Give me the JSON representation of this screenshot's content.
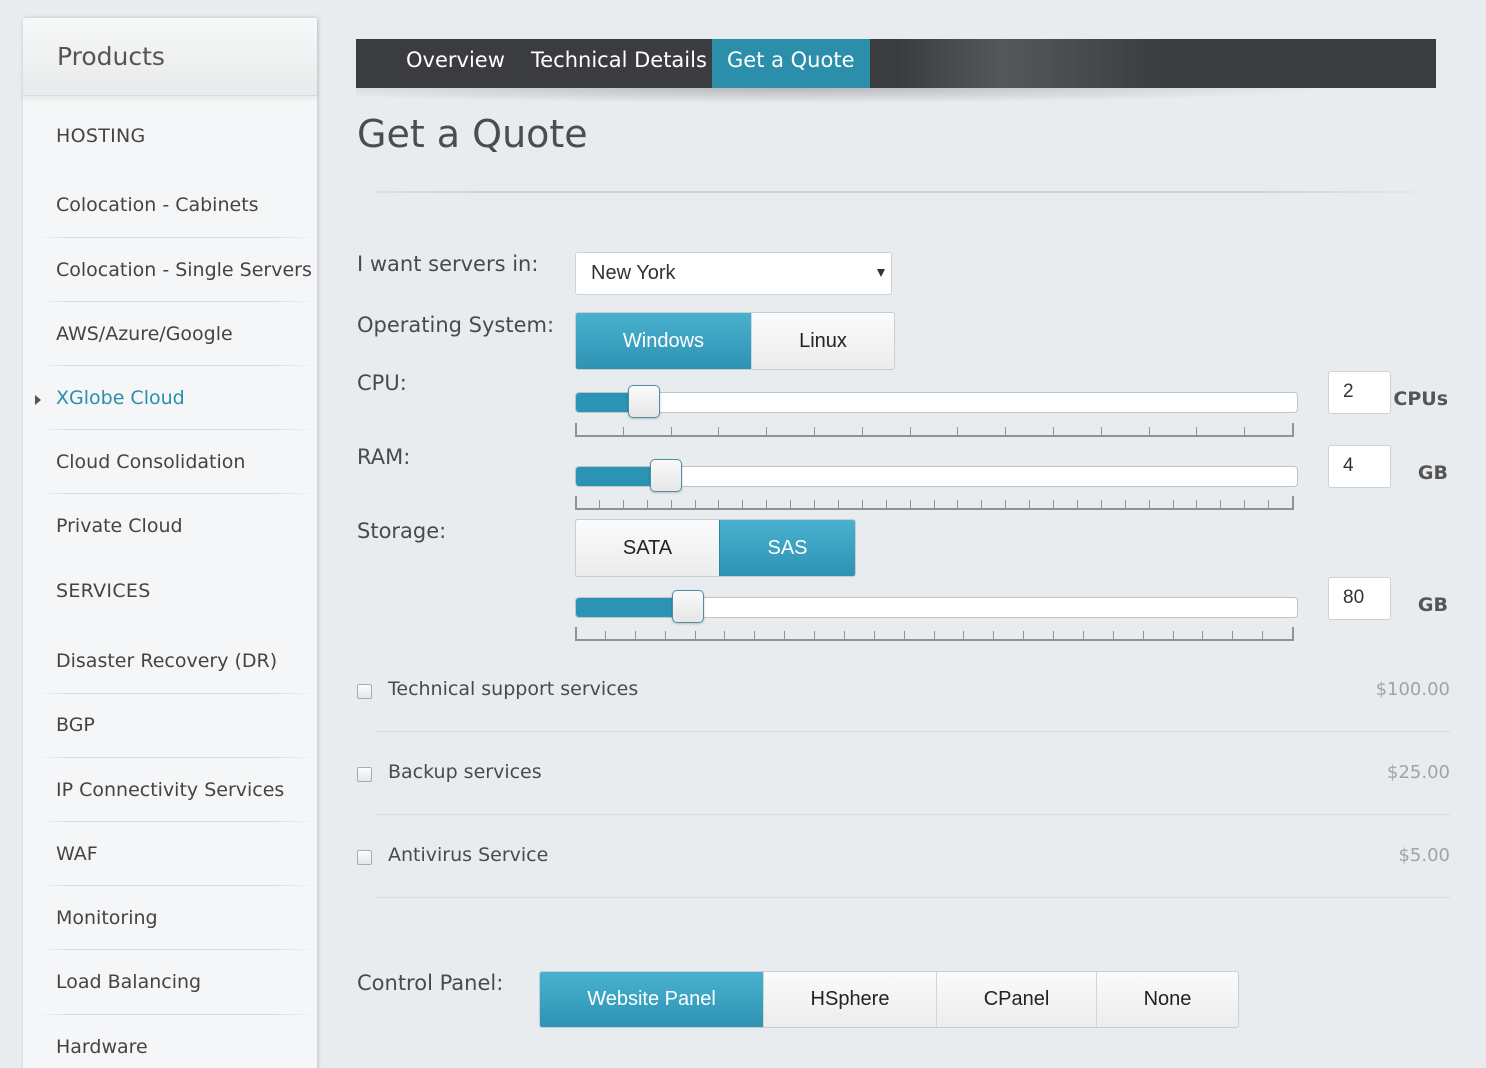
{
  "sidebar": {
    "title": "Products",
    "sections": {
      "hosting": "HOSTING",
      "services": "SERVICES"
    },
    "items": [
      {
        "label": "Colocation - Cabinets"
      },
      {
        "label": "Colocation - Single Servers"
      },
      {
        "label": "AWS/Azure/Google"
      },
      {
        "label": "XGlobe Cloud",
        "active": true
      },
      {
        "label": "Cloud Consolidation"
      },
      {
        "label": "Private Cloud"
      },
      {
        "label": "Disaster Recovery (DR)"
      },
      {
        "label": "BGP"
      },
      {
        "label": "IP Connectivity Services"
      },
      {
        "label": "WAF"
      },
      {
        "label": "Monitoring"
      },
      {
        "label": "Load Balancing"
      },
      {
        "label": "Hardware"
      }
    ]
  },
  "tabs": [
    {
      "label": "Overview"
    },
    {
      "label": "Technical Details"
    },
    {
      "label": "Get a Quote",
      "active": true
    }
  ],
  "page": {
    "title": "Get a Quote"
  },
  "form": {
    "location": {
      "label": "I want servers in:",
      "value": "New York"
    },
    "os": {
      "label": "Operating System:",
      "options": [
        "Windows",
        "Linux"
      ],
      "selected": "Windows"
    },
    "cpu": {
      "label": "CPU:",
      "value": "2",
      "unit": "CPUs",
      "level": 0.07
    },
    "ram": {
      "label": "RAM:",
      "value": "4",
      "unit": "GB",
      "level": 0.1
    },
    "storage": {
      "label": "Storage:",
      "options": [
        "SATA",
        "SAS"
      ],
      "selected": "SAS",
      "value": "80",
      "unit": "GB",
      "level": 0.13
    },
    "addons": [
      {
        "label": "Technical support services",
        "price": "$100.00",
        "checked": false
      },
      {
        "label": "Backup services",
        "price": "$25.00",
        "checked": false
      },
      {
        "label": "Antivirus Service",
        "price": "$5.00",
        "checked": false
      }
    ],
    "control_panel": {
      "label": "Control Panel:",
      "options": [
        "Website Panel",
        "HSphere",
        "CPanel",
        "None"
      ],
      "selected": "Website Panel"
    }
  },
  "colors": {
    "accent": "#2b8fab",
    "tabbar": "#3a3c3f",
    "page_bg": "#e9ecee"
  }
}
